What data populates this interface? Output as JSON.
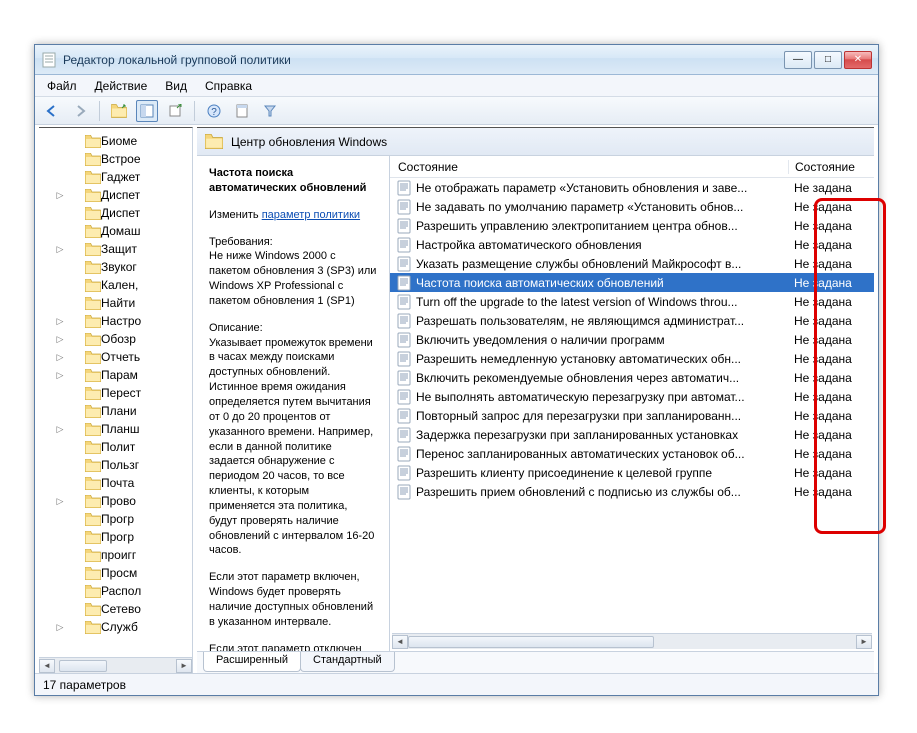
{
  "window": {
    "title": "Редактор локальной групповой политики"
  },
  "menu": {
    "file": "Файл",
    "action": "Действие",
    "view": "Вид",
    "help": "Справка"
  },
  "tree": {
    "items": [
      {
        "label": "Биоме",
        "exp": ""
      },
      {
        "label": "Встрое",
        "exp": ""
      },
      {
        "label": "Гаджет",
        "exp": ""
      },
      {
        "label": "Диспет",
        "exp": "▷"
      },
      {
        "label": "Диспет",
        "exp": ""
      },
      {
        "label": "Домаш",
        "exp": ""
      },
      {
        "label": "Защит",
        "exp": "▷"
      },
      {
        "label": "Звуког",
        "exp": ""
      },
      {
        "label": "Кален,",
        "exp": ""
      },
      {
        "label": "Найти",
        "exp": ""
      },
      {
        "label": "Настро",
        "exp": "▷"
      },
      {
        "label": "Обозр",
        "exp": "▷"
      },
      {
        "label": "Отчеть",
        "exp": "▷"
      },
      {
        "label": "Парам",
        "exp": "▷"
      },
      {
        "label": "Перест",
        "exp": ""
      },
      {
        "label": "Плани",
        "exp": ""
      },
      {
        "label": "Планш",
        "exp": "▷"
      },
      {
        "label": "Полит",
        "exp": ""
      },
      {
        "label": "Пользг",
        "exp": ""
      },
      {
        "label": "Почта",
        "exp": ""
      },
      {
        "label": "Прово",
        "exp": "▷"
      },
      {
        "label": "Прогр",
        "exp": ""
      },
      {
        "label": "Прогр",
        "exp": ""
      },
      {
        "label": "проигг",
        "exp": ""
      },
      {
        "label": "Просм",
        "exp": ""
      },
      {
        "label": "Распол",
        "exp": ""
      },
      {
        "label": "Сетево",
        "exp": ""
      },
      {
        "label": "Служб",
        "exp": "▷"
      }
    ]
  },
  "details": {
    "breadcrumb": "Центр обновления Windows",
    "title": "Частота поиска автоматических обновлений",
    "edit_prefix": "Изменить",
    "edit_link": "параметр политики",
    "req_label": "Требования:",
    "req_text": "Не ниже Windows 2000 с пакетом обновления 3 (SP3) или Windows XP Professional с пакетом обновления 1 (SP1)",
    "desc_label": "Описание:",
    "desc_text1": "Указывает промежуток времени в часах между поисками доступных обновлений. Истинное время ожидания определяется путем вычитания от 0 до 20 процентов от указанного времени. Например, если в данной политике задается обнаружение с периодом 20 часов, то все клиенты, к которым применяется эта политика, будут проверять наличие обновлений с интервалом 16-20 часов.",
    "desc_text2": "Если этот параметр включен, Windows будет проверять наличие доступных обновлений в указанном интервале.",
    "desc_text3": "Если этот параметр отключен"
  },
  "list": {
    "col_state_header": "Состояние",
    "col_state2_header": "Состояние",
    "rows": [
      {
        "name": "Не отображать параметр «Установить обновления и заве...",
        "state": "Не задана",
        "sel": false
      },
      {
        "name": "Не задавать по умолчанию параметр «Установить обнов...",
        "state": "Не задана",
        "sel": false
      },
      {
        "name": "Разрешить управлению электропитанием центра обнов...",
        "state": "Не задана",
        "sel": false
      },
      {
        "name": "Настройка автоматического обновления",
        "state": "Не задана",
        "sel": false
      },
      {
        "name": "Указать размещение службы обновлений Майкрософт в...",
        "state": "Не задана",
        "sel": false
      },
      {
        "name": "Частота поиска автоматических обновлений",
        "state": "Не задана",
        "sel": true
      },
      {
        "name": "Turn off the upgrade to the latest version of Windows throu...",
        "state": "Не задана",
        "sel": false
      },
      {
        "name": "Разрешать пользователям, не являющимся администрат...",
        "state": "Не задана",
        "sel": false
      },
      {
        "name": "Включить уведомления о наличии программ",
        "state": "Не задана",
        "sel": false
      },
      {
        "name": "Разрешить немедленную установку автоматических обн...",
        "state": "Не задана",
        "sel": false
      },
      {
        "name": "Включить рекомендуемые обновления через автоматич...",
        "state": "Не задана",
        "sel": false
      },
      {
        "name": "Не выполнять автоматическую перезагрузку при автомат...",
        "state": "Не задана",
        "sel": false
      },
      {
        "name": "Повторный запрос для перезагрузки при запланированн...",
        "state": "Не задана",
        "sel": false
      },
      {
        "name": "Задержка перезагрузки при запланированных установках",
        "state": "Не задана",
        "sel": false
      },
      {
        "name": "Перенос запланированных автоматических установок об...",
        "state": "Не задана",
        "sel": false
      },
      {
        "name": "Разрешить клиенту присоединение к целевой группе",
        "state": "Не задана",
        "sel": false
      },
      {
        "name": "Разрешить прием обновлений с подписью из службы об...",
        "state": "Не задана",
        "sel": false
      }
    ]
  },
  "tabs": {
    "extended": "Расширенный",
    "standard": "Стандартный"
  },
  "status": {
    "text": "17 параметров"
  }
}
